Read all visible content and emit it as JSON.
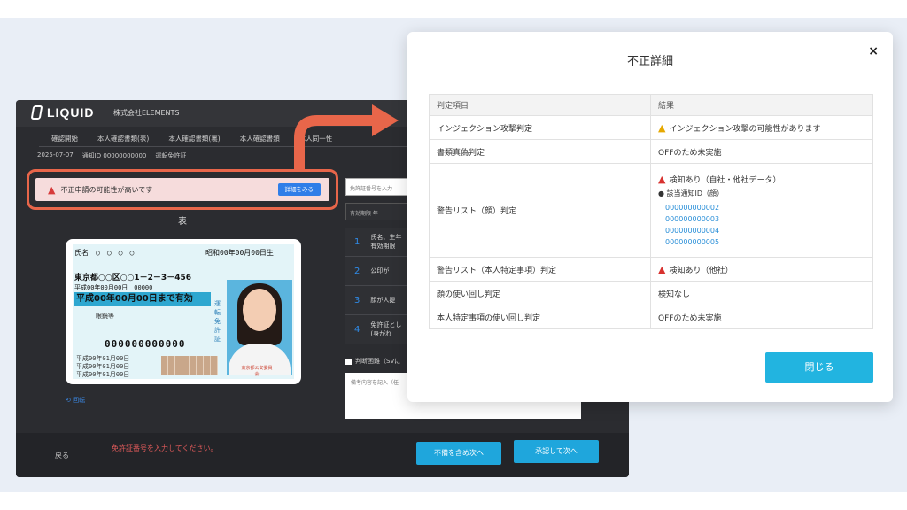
{
  "app": {
    "logo": "LIQUID",
    "company": "株式会社ELEMENTS",
    "nav": [
      "確認開始",
      "本人確認書類(表)",
      "本人確認書類(裏)",
      "本人確認書類",
      "本人同一性"
    ],
    "meta": [
      "2025-07-07",
      "通知ID 00000000000",
      "運転免許証"
    ],
    "alert_text": "不正申請の可能性が高いです",
    "alert_button": "詳細をみる",
    "card_title": "表",
    "reload": "回転",
    "form_input_placeholder": "免許証番号を入力",
    "form_select": "有効期限 年",
    "form_items": [
      {
        "num": "1",
        "text": "氏名、生年\n有効期限"
      },
      {
        "num": "2",
        "text": "公印が"
      },
      {
        "num": "3",
        "text": "顔が人提"
      },
      {
        "num": "4",
        "text": "免許証とし\n(身がれ"
      }
    ],
    "check_label": "判断困難（SVに",
    "textarea_placeholder": "備考内容を記入（任",
    "bottom": {
      "back": "戻る",
      "error": "免許証番号を入力してください。",
      "hold_button": "不備を含め次へ",
      "next_button": "承認して次へ"
    }
  },
  "id_card": {
    "name_row": "氏名　○　○　○　○",
    "dob": "昭和00年00月00日生",
    "address": "東京都○○区○○1－2－3－456",
    "issue": "平成00年00月00日　00000",
    "valid_until": "平成00年00月00日まで有効",
    "cond": "眼鏡等",
    "license_number": "000000000000",
    "dates": [
      "平成00年01月00日",
      "平成00年01月00日",
      "平成00年01月00日"
    ],
    "side_label": "運転免許証",
    "stamp": "東京都公安委員会"
  },
  "modal": {
    "title": "不正詳細",
    "close": "×",
    "columns": [
      "判定項目",
      "結果"
    ],
    "rows": [
      {
        "item": "インジェクション攻撃判定",
        "result": "インジェクション攻撃の可能性があります"
      },
      {
        "item": "書類真偽判定",
        "result": "OFFのため未実施"
      },
      {
        "item": "警告リスト（顔）判定",
        "result": "検知あり（自社・他社データ）",
        "sub_label": "● 該当通知ID（顔）",
        "ids": [
          "000000000002",
          "000000000003",
          "000000000004",
          "000000000005"
        ]
      },
      {
        "item": "警告リスト（本人特定事項）判定",
        "result": "検知あり（他社）"
      },
      {
        "item": "顔の使い回し判定",
        "result": "検知なし"
      },
      {
        "item": "本人特定事項の使い回し判定",
        "result": "OFFのため未実施"
      }
    ],
    "close_button": "閉じる"
  }
}
